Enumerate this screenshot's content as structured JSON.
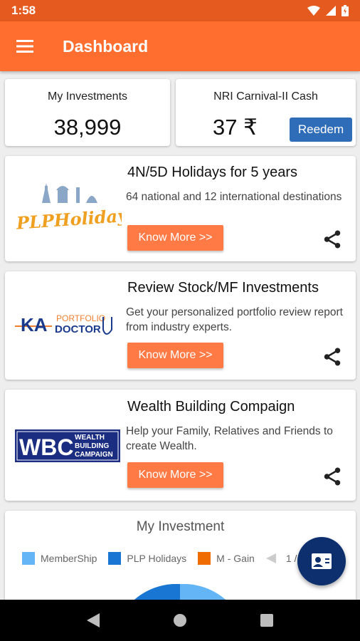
{
  "status_bar": {
    "time": "1:58"
  },
  "app_bar": {
    "title": "Dashboard"
  },
  "investments": {
    "label": "My Investments",
    "value": "38,999"
  },
  "carnival": {
    "label": "NRI Carnival-II Cash",
    "value": "37 ₹",
    "redeem_label": "Reedem",
    "redeem_color": "#2f6db8"
  },
  "promos": [
    {
      "title": "4N/5D Holidays for 5 years",
      "description": "64 national and 12 international destinations",
      "button": "Know More >>",
      "logo_text": "PLPHolidays"
    },
    {
      "title": "Review Stock/MF Investments",
      "description": "Get your personalized portfolio review report from industry experts.",
      "button": "Know More >>",
      "logo_text": {
        "main": "KA",
        "line1": "PORTFOLIO",
        "line2": "DOCTOR"
      }
    },
    {
      "title": "Wealth Building Compaign",
      "description": "Help your Family, Relatives and Friends to create Wealth.",
      "button": "Know More >>",
      "logo_text": {
        "main": "WBC",
        "line1": "WEALTH",
        "line2": "BUILDING",
        "line3": "CAMPAIGN"
      }
    }
  ],
  "chart": {
    "title": "My Investment",
    "legend": [
      {
        "label": "MemberShip",
        "color": "#64b5f6"
      },
      {
        "label": "PLP Holidays",
        "color": "#1976d2"
      },
      {
        "label": "M - Gain",
        "color": "#ef6c00"
      }
    ],
    "legend_more": "1 /"
  },
  "colors": {
    "primary": "#ff6e2f",
    "status_bar": "#e55a1e",
    "button": "#ff7a45",
    "fab": "#0d2f6e"
  }
}
